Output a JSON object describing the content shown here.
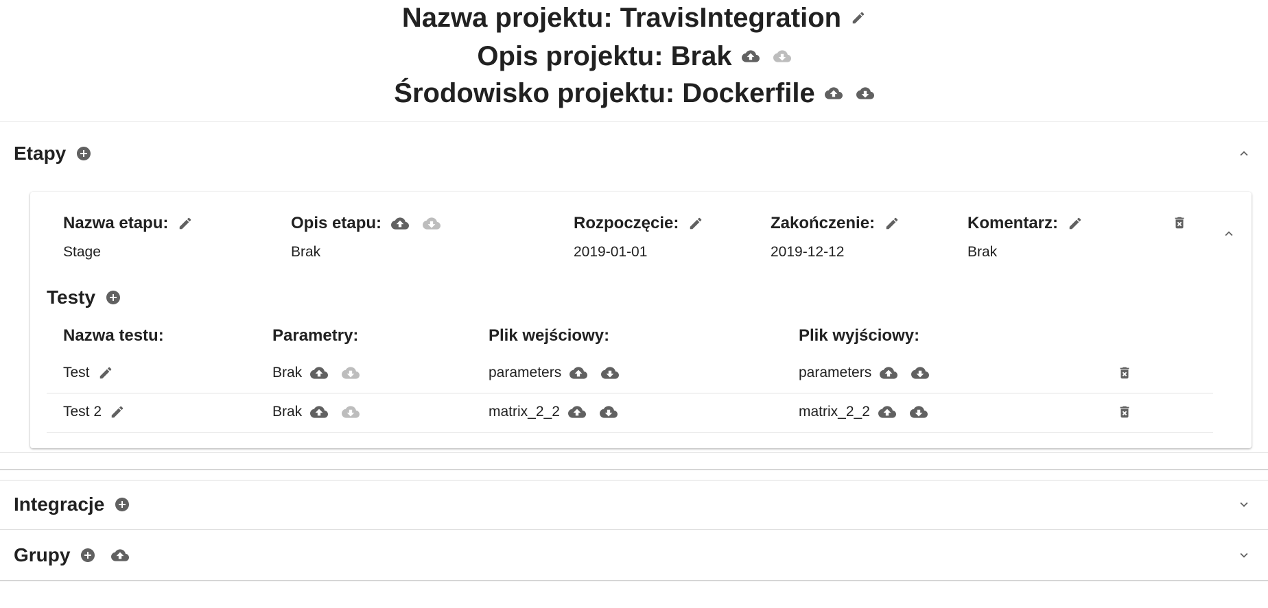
{
  "project": {
    "name_line": "Nazwa projektu: TravisIntegration",
    "description_line": "Opis projektu: Brak",
    "environment_line": "Środowisko projektu: Dockerfile"
  },
  "sections": {
    "stages": {
      "title": "Etapy",
      "stage": {
        "name_label": "Nazwa etapu:",
        "name_value": "Stage",
        "description_label": "Opis etapu:",
        "description_value": "Brak",
        "start_label": "Rozpoczęcie:",
        "start_value": "2019-01-01",
        "end_label": "Zakończenie:",
        "end_value": "2019-12-12",
        "comment_label": "Komentarz:",
        "comment_value": "Brak",
        "tests": {
          "title": "Testy",
          "headers": [
            "Nazwa testu:",
            "Parametry:",
            "Plik wejściowy:",
            "Plik wyjściowy:"
          ],
          "rows": [
            {
              "name": "Test",
              "parameters": "Brak",
              "input_file": "parameters",
              "output_file": "parameters"
            },
            {
              "name": "Test 2",
              "parameters": "Brak",
              "input_file": "matrix_2_2",
              "output_file": "matrix_2_2"
            }
          ]
        }
      }
    },
    "integrations": {
      "title": "Integracje"
    },
    "groups": {
      "title": "Grupy"
    }
  },
  "icons": {
    "edit": "pencil-icon",
    "upload": "cloud-upload-icon",
    "download": "cloud-download-icon",
    "add": "add-circle-icon",
    "delete": "delete-forever-icon",
    "expand_less": "chevron-up-icon",
    "expand_more": "chevron-down-icon"
  },
  "colors": {
    "icon_active": "#616161",
    "icon_disabled": "#bdbdbd",
    "text": "#212121",
    "divider": "#e0e0e0"
  }
}
